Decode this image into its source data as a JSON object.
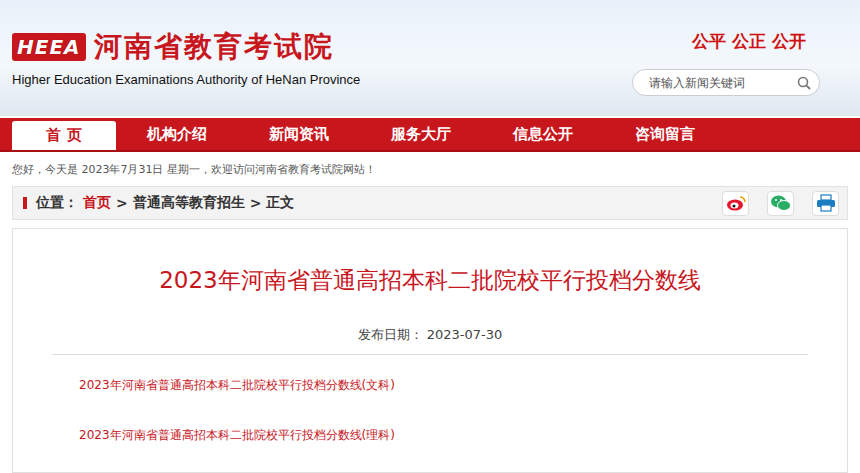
{
  "header": {
    "logo_mark": "HEEA",
    "title": "河南省教育考试院",
    "subtitle": "Higher Education Examinations Authority of HeNan Province",
    "slogan": "公平 公正 公开",
    "search": {
      "placeholder": "请输入新闻关键词"
    }
  },
  "nav": {
    "items": [
      {
        "label": "首 页",
        "selected": true
      },
      {
        "label": "机构介绍",
        "selected": false
      },
      {
        "label": "新闻资讯",
        "selected": false
      },
      {
        "label": "服务大厅",
        "selected": false
      },
      {
        "label": "信息公开",
        "selected": false
      },
      {
        "label": "咨询留言",
        "selected": false
      }
    ]
  },
  "welcome": "您好，今天是 2023年7月31日 星期一，欢迎访问河南省教育考试院网站！",
  "breadcrumb": {
    "label": "位置：",
    "separator": ">",
    "items": [
      {
        "label": "首页",
        "link": true
      },
      {
        "label": "普通高等教育招生",
        "link": false
      },
      {
        "label": "正文",
        "link": false
      }
    ]
  },
  "article": {
    "title": "2023年河南省普通高招本科二批院校平行投档分数线",
    "date_label": "发布日期：",
    "date": "2023-07-30",
    "links": [
      "2023年河南省普通高招本科二批院校平行投档分数线(文科)",
      "2023年河南省普通高招本科二批院校平行投档分数线(理科)"
    ]
  }
}
